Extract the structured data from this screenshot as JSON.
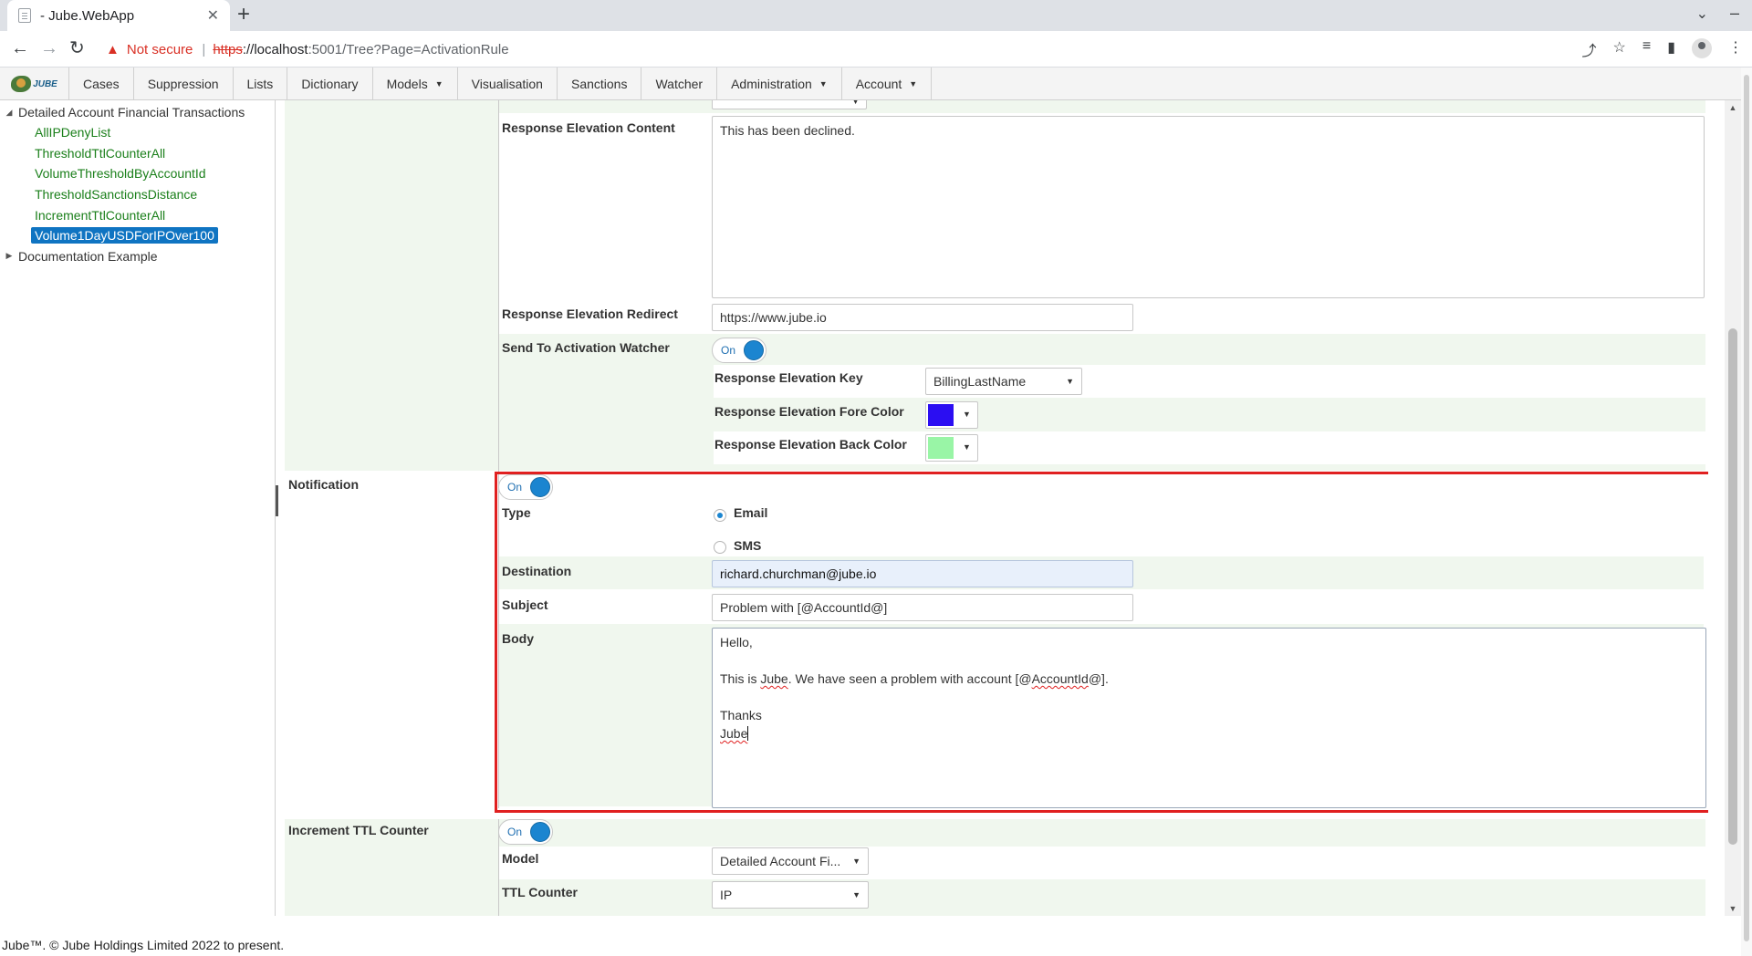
{
  "browser": {
    "tab_title": "- Jube.WebApp",
    "tab_close": "✕",
    "new_tab": "+",
    "security_label": "Not secure",
    "url_scheme": "https",
    "url_host": "://localhost",
    "url_rest": ":5001/Tree?Page=ActivationRule"
  },
  "nav": {
    "logo_text": "JUBE",
    "items": [
      "Cases",
      "Suppression",
      "Lists",
      "Dictionary",
      "Models",
      "Visualisation",
      "Sanctions",
      "Watcher",
      "Administration",
      "Account"
    ]
  },
  "tree": {
    "root": "Detailed Account Financial Transactions",
    "children": [
      "AllIPDenyList",
      "ThresholdTtlCounterAll",
      "VolumeThresholdByAccountId",
      "ThresholdSanctionsDistance",
      "IncrementTtlCounterAll",
      "Volume1DayUSDForIPOver100"
    ],
    "selected_index": 5,
    "second_root": "Documentation Example"
  },
  "form": {
    "response_elevation_content_label": "Response Elevation Content",
    "response_elevation_content_value": "This has been declined.",
    "response_elevation_redirect_label": "Response Elevation Redirect",
    "response_elevation_redirect_value": "https://www.jube.io",
    "send_to_watcher_label": "Send To Activation Watcher",
    "toggle_on": "On",
    "response_elevation_key_label": "Response Elevation Key",
    "response_elevation_key_value": "BillingLastName",
    "fore_color_label": "Response Elevation Fore Color",
    "fore_color": "#2b0ef2",
    "back_color_label": "Response Elevation Back Color",
    "back_color": "#99f5a6",
    "notification_label": "Notification",
    "type_label": "Type",
    "type_email": "Email",
    "type_sms": "SMS",
    "destination_label": "Destination",
    "destination_value": "richard.churchman@jube.io",
    "subject_label": "Subject",
    "subject_value": "Problem with [@AccountId@]",
    "body_label": "Body",
    "body_line1": "Hello,",
    "body_line2_a": "This is ",
    "body_line2_b": "Jube",
    "body_line2_c": ".  We have seen a problem with account [@",
    "body_line2_d": "AccountId",
    "body_line2_e": "@].",
    "body_line3": "Thanks",
    "body_line4": "Jube",
    "increment_label": "Increment TTL Counter",
    "model_label": "Model",
    "model_value": "Detailed Account Fi...",
    "ttl_counter_label": "TTL Counter",
    "ttl_counter_value": "IP"
  },
  "footer": "Jube™. © Jube Holdings Limited 2022 to present.",
  "colors": {
    "highlight": "#e02020",
    "selected_tree": "#0f74c2",
    "toggle_knob": "#1b85d0"
  }
}
